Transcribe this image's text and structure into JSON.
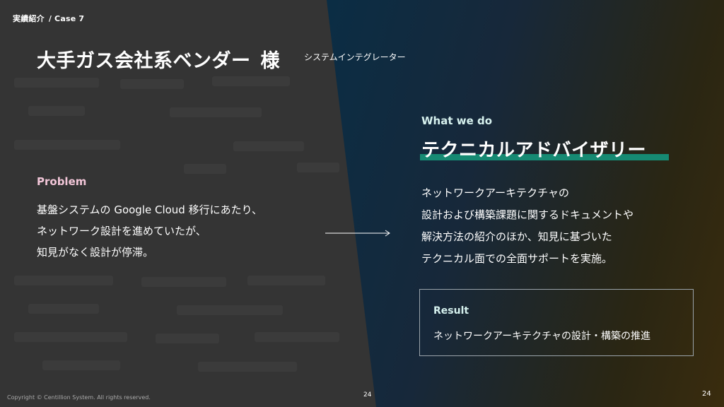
{
  "header": {
    "breadcrumb_section": "実績紹介",
    "breadcrumb_case": "/ Case 7",
    "client_name": "大手ガス会社系ベンダー",
    "client_honorific": "様",
    "client_type": "システムインテグレーター"
  },
  "problem": {
    "label": "Problem",
    "lines": [
      "基盤システムの Google Cloud 移行にあたり、",
      "ネットワーク設計を進めていたが、",
      "知見がなく設計が停滞。"
    ]
  },
  "solution": {
    "label": "What we do",
    "title": "テクニカルアドバイザリー",
    "lines": [
      "ネットワークアーキテクチャの",
      "設計および構築課題に関するドキュメントや",
      "解決方法の紹介のほか、知見に基づいた",
      "テクニカル面での全面サポートを実施。"
    ]
  },
  "result": {
    "label": "Result",
    "text": "ネットワークアーキテクチャの設計・構築の推進"
  },
  "footer": {
    "copyright": "Copyright © Centillion System. All rights reserved.",
    "page_number_center": "24",
    "page_number_right": "24"
  },
  "colors": {
    "accent_underline": "#168a73",
    "problem_label": "#f2c6d8",
    "left_panel": "#343434"
  }
}
